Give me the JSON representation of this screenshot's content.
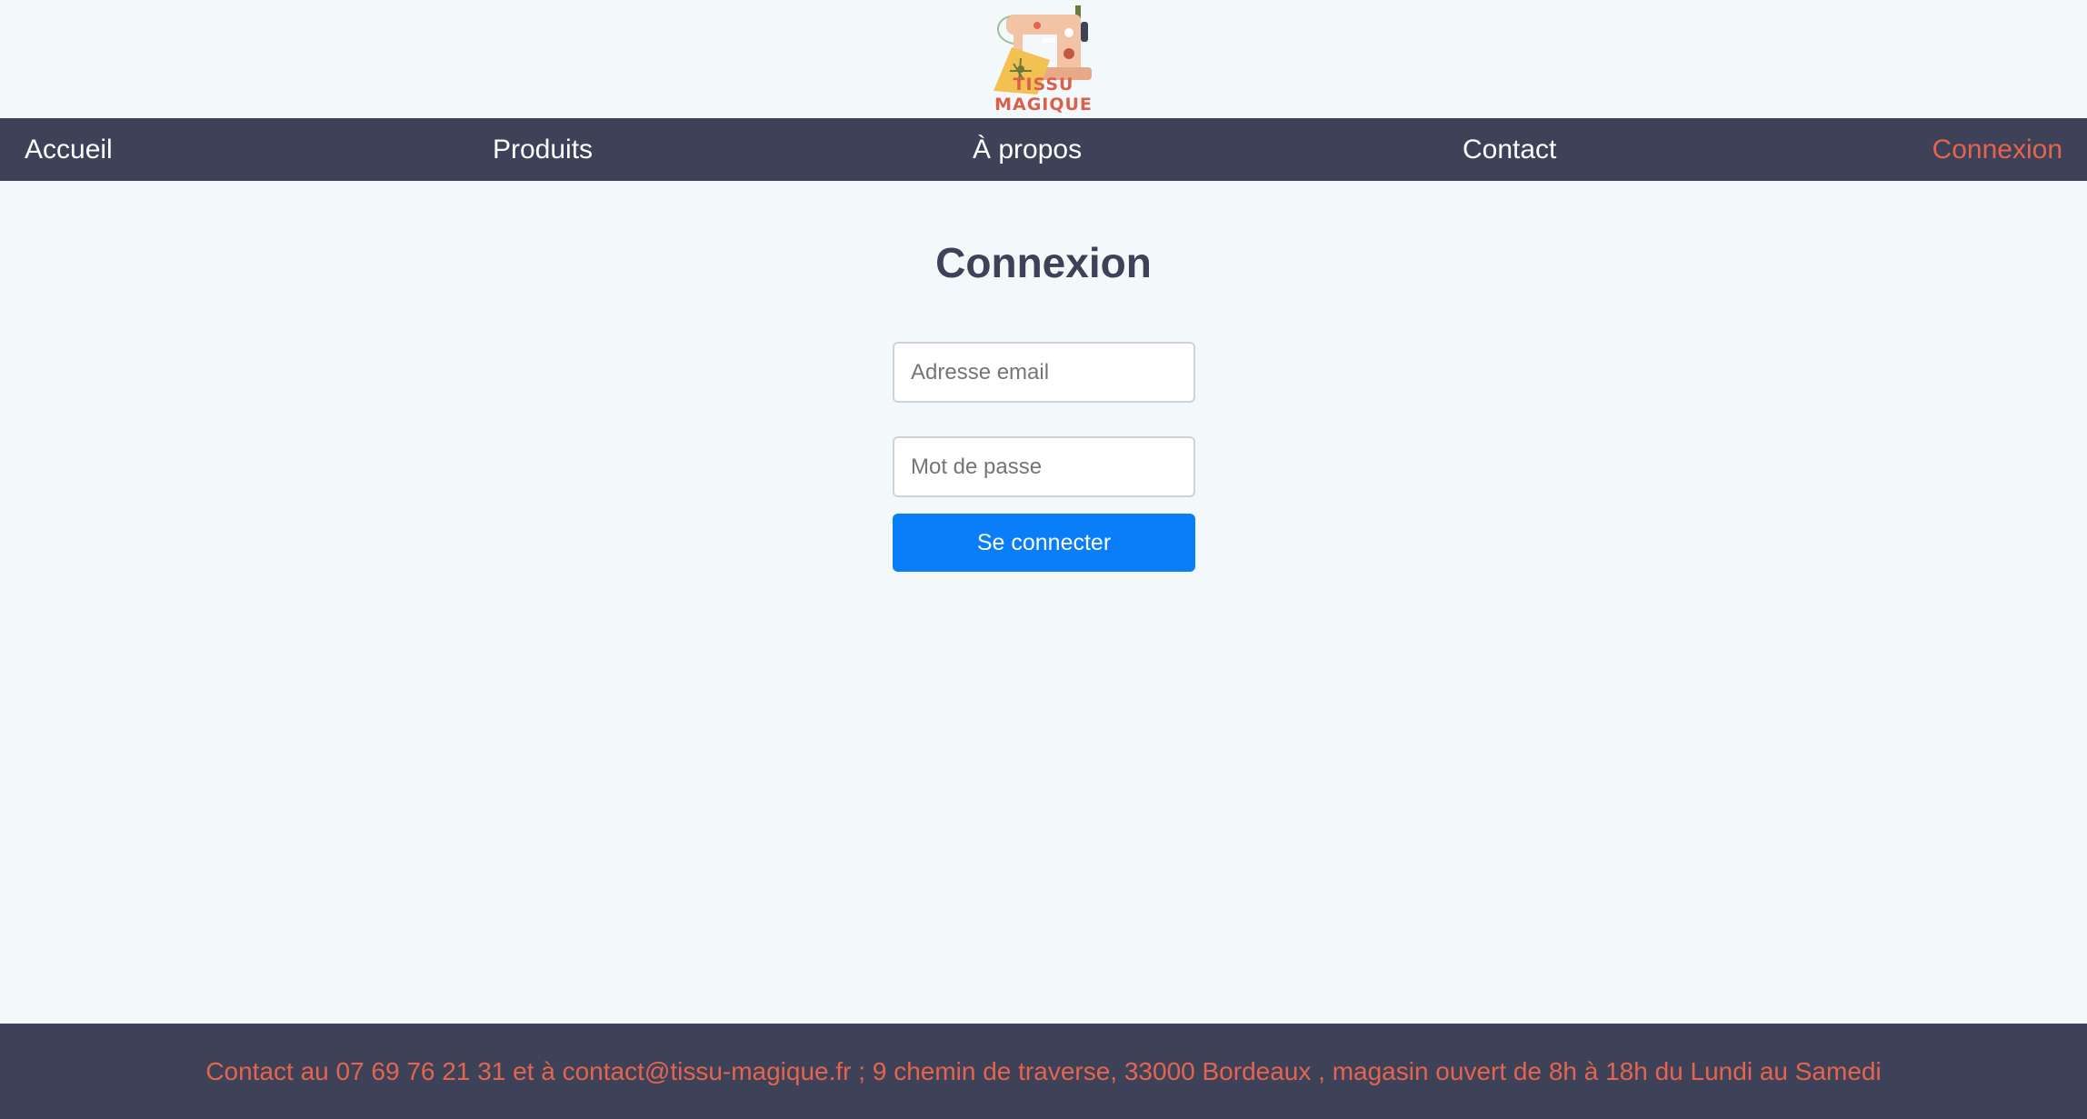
{
  "brand": {
    "logo_text": "TISSU MAGIQUE",
    "logo_icon": "sewing-machine-icon",
    "logo_text_color": "#d9614b"
  },
  "nav": {
    "items": [
      {
        "label": "Accueil"
      },
      {
        "label": "Produits"
      },
      {
        "label": "À propos"
      },
      {
        "label": "Contact"
      },
      {
        "label": "Connexion",
        "active": true
      }
    ],
    "background": "#3d4259",
    "active_color": "#e5644d"
  },
  "login": {
    "title": "Connexion",
    "email_placeholder": "Adresse email",
    "password_placeholder": "Mot de passe",
    "submit_label": "Se connecter",
    "submit_color": "#0a7df9"
  },
  "footer": {
    "text": "Contact au 07 69 76 21 31 et à contact@tissu-magique.fr ; 9 chemin de traverse, 33000 Bordeaux , magasin ouvert de 8h à 18h du Lundi au Samedi",
    "text_color": "#e5644d"
  }
}
